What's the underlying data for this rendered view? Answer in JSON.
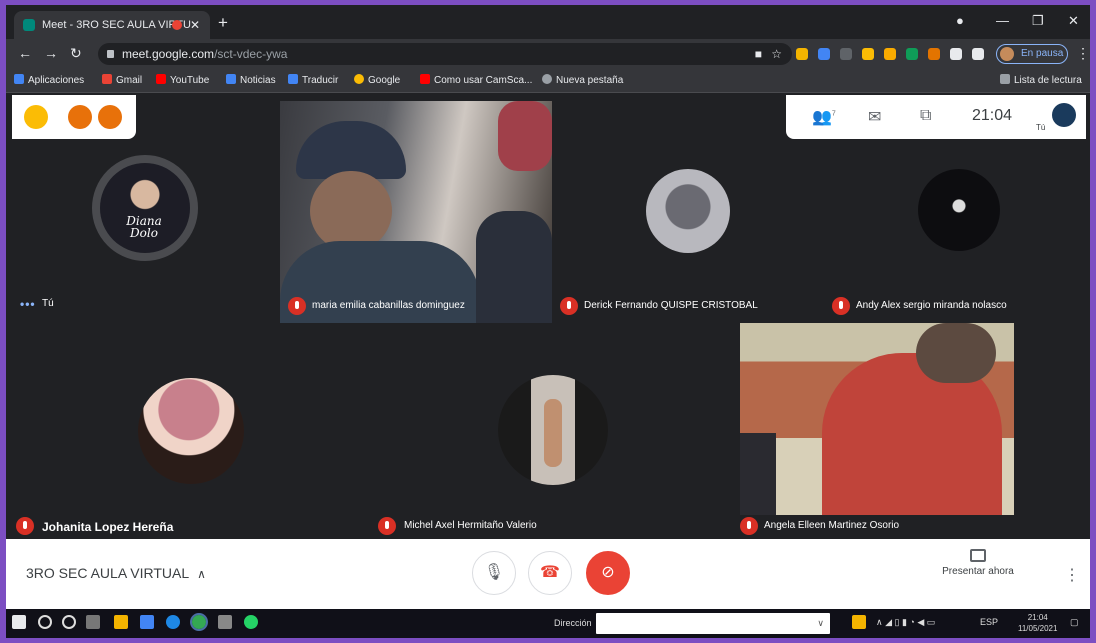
{
  "browser": {
    "tab_title": "Meet - 3RO SEC AULA VIRTU",
    "url_domain": "meet.google.com",
    "url_path": "/sct-vdec-ywa",
    "profile_status": "En pausa",
    "reading_list": "Lista de lectura"
  },
  "bookmarks": [
    {
      "label": "Aplicaciones",
      "color": "#4285f4"
    },
    {
      "label": "Gmail",
      "color": "#ea4335"
    },
    {
      "label": "YouTube",
      "color": "#ff0000"
    },
    {
      "label": "Noticias",
      "color": "#4285f4"
    },
    {
      "label": "Traducir",
      "color": "#4285f4"
    },
    {
      "label": "Google",
      "color": "#fbbc05"
    },
    {
      "label": "Como usar CamSca...",
      "color": "#ff0000"
    },
    {
      "label": "Nueva pestaña",
      "color": "#9aa0a6"
    }
  ],
  "meet": {
    "time": "21:04",
    "self_short": "Tú",
    "participant_count_badge": "7",
    "participants": [
      {
        "name": "Tú",
        "avatar_text": "Diana Dolo"
      },
      {
        "name": "maria emilia cabanillas dominguez"
      },
      {
        "name": "Derick Fernando QUISPE CRISTOBAL"
      },
      {
        "name": "Andy Alex sergio miranda nolasco"
      },
      {
        "name": "Johanita Lopez Hereña"
      },
      {
        "name": "Michel Axel Hermitaño Valerio"
      },
      {
        "name": "Angela Elleen Martinez Osorio"
      }
    ],
    "meeting_name": "3RO SEC AULA VIRTUAL",
    "present_label": "Presentar ahora"
  },
  "taskbar": {
    "search_label": "Dirección",
    "lang": "ESP",
    "clock_time": "21:04",
    "clock_date": "11/05/2021"
  },
  "colors": {
    "meet_bg": "#202124",
    "mute_red": "#d93025",
    "end_call_red": "#ea4335",
    "accent_blue": "#8ab4f8",
    "frame_purple": "#7c4ec2"
  }
}
